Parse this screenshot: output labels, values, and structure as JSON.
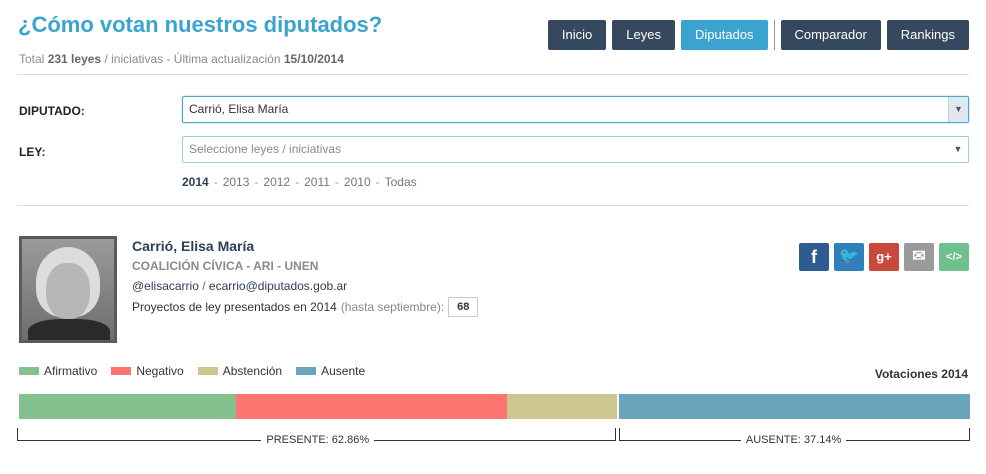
{
  "header": {
    "title": "¿Cómo votan nuestros diputados?",
    "subtitle_prefix": "Total",
    "subtitle_count": "231 leyes",
    "subtitle_mid": "/ iniciativas - Última actualización",
    "subtitle_date": "15/10/2014"
  },
  "nav": {
    "items": [
      {
        "label": "Inicio"
      },
      {
        "label": "Leyes"
      },
      {
        "label": "Diputados",
        "active": true
      },
      {
        "label": "Comparador"
      },
      {
        "label": "Rankings"
      }
    ]
  },
  "filters": {
    "diputado_label": "DIPUTADO:",
    "diputado_value": "Carrió, Elisa María",
    "ley_label": "LEY:",
    "ley_placeholder": "Seleccione leyes / iniciativas",
    "years": [
      "2014",
      "2013",
      "2012",
      "2011",
      "2010",
      "Todas"
    ],
    "active_year": "2014"
  },
  "deputy": {
    "name": "Carrió, Elisa María",
    "party": "COALICIÓN CÍVICA - ARI - UNEN",
    "twitter": "@elisacarrio",
    "contact_sep": "/",
    "email": "ecarrio@diputados.gob.ar",
    "projects_label": "Proyectos de ley presentados en 2014",
    "projects_note": "(hasta septiembre):",
    "projects_count": "68"
  },
  "social": [
    {
      "name": "facebook",
      "glyph": "f"
    },
    {
      "name": "twitter",
      "glyph": "🐦"
    },
    {
      "name": "google-plus",
      "glyph": "g+"
    },
    {
      "name": "email",
      "glyph": "✉"
    },
    {
      "name": "embed",
      "glyph": "</>"
    }
  ],
  "legend": [
    {
      "label": "Afirmativo",
      "color": "#85c08f"
    },
    {
      "label": "Negativo",
      "color": "#fd7470"
    },
    {
      "label": "Abstención",
      "color": "#cbc78f"
    },
    {
      "label": "Ausente",
      "color": "#6aa5bb"
    }
  ],
  "votes": {
    "title": "Votaciones 2014",
    "segments": [
      {
        "name": "Afirmativo",
        "fraction": 0.228,
        "color": "#85c08f"
      },
      {
        "name": "Negativo",
        "fraction": 0.285,
        "color": "#fd7470"
      },
      {
        "name": "Abstención",
        "fraction": 0.1156,
        "color": "#cbc78f"
      },
      {
        "name": "Ausente",
        "fraction": 0.3714,
        "color": "#6aa5bb"
      }
    ],
    "presente_label": "PRESENTE: 62.86%",
    "ausente_label": "AUSENTE: 37.14%"
  }
}
